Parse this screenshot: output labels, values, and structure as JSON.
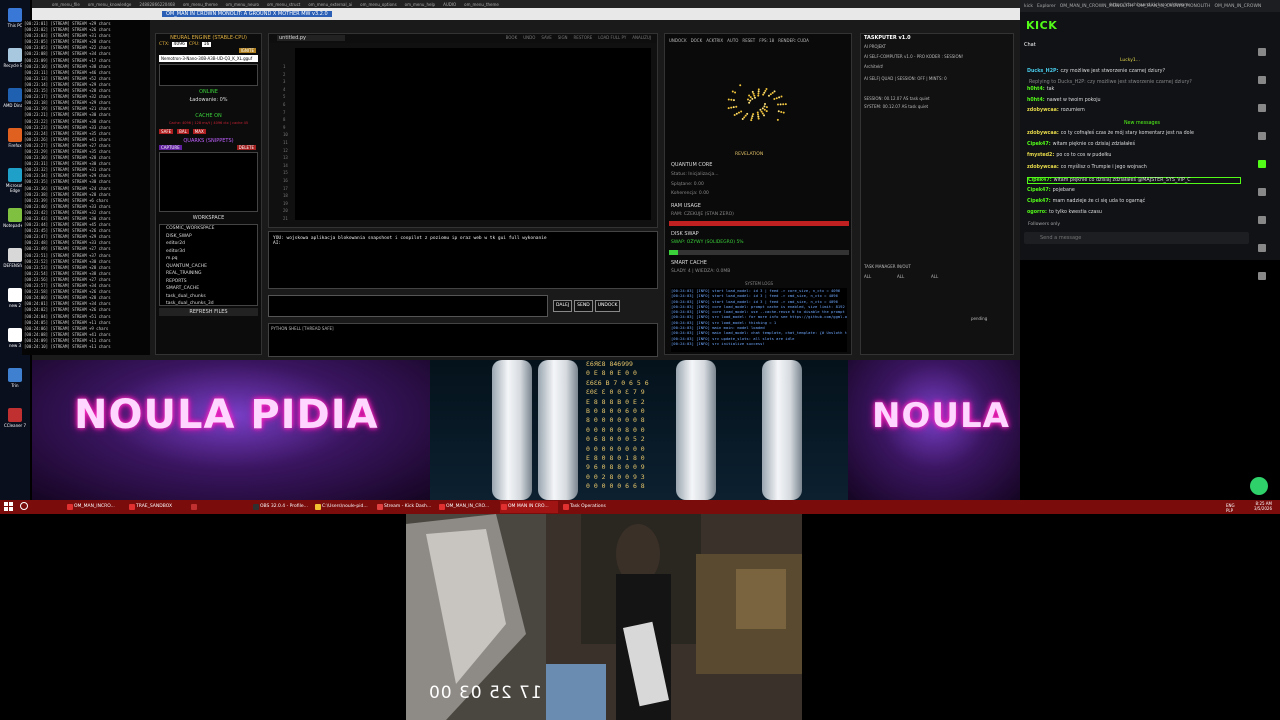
{
  "desktop": {
    "icons": [
      {
        "name": "recycle-bin-icon",
        "label": "This PC",
        "color": "#3a78d8"
      },
      {
        "name": "recycle-bin-icon-2",
        "label": "Recycle Bin",
        "color": "#a8c8e0"
      },
      {
        "name": "amd-icon",
        "label": "AMD Dina...",
        "color": "#2060b0"
      },
      {
        "name": "firefox-icon",
        "label": "Firefox",
        "color": "#e06020"
      },
      {
        "name": "edge-icon",
        "label": "Microsoft Edge",
        "color": "#1fa0c8"
      },
      {
        "name": "notepad-icon",
        "label": "Notepad++",
        "color": "#80c040"
      },
      {
        "name": "file-icon",
        "label": "DEFENSIV...",
        "color": "#d8d8d8"
      },
      {
        "name": "file-icon-2",
        "label": "new 2",
        "color": "#ffffff"
      },
      {
        "name": "file-icon-3",
        "label": "new 3",
        "color": "#ffffff"
      },
      {
        "name": "app-icon",
        "label": "Trin",
        "color": "#4080d0"
      },
      {
        "name": "ccleaner-icon",
        "label": "CCleaner 7",
        "color": "#c03030"
      }
    ]
  },
  "window": {
    "title": "OM_MAN IN CROWN MONOLIT: A GROUND X MOTHER MW v3.2.0",
    "tabs": [
      "om_menu_file",
      "om_menu_knowledge",
      "24882866220468",
      "om_menu_theme",
      "om_menu_neuro",
      "om_menu_struct",
      "om_menu_external_ai",
      "om_menu_options",
      "om_menu_help",
      "AUDIO",
      "om_menu_theme"
    ],
    "menu": [
      "File",
      "Edit",
      "View",
      "Tools",
      "Window",
      "Help"
    ]
  },
  "log": {
    "lines": [
      "[00:23:01] [STREAM] STREAM +29 chars",
      "[00:23:02] [STREAM] STREAM +26 chars",
      "[00:23:03] [STREAM] STREAM +31 chars",
      "[00:23:05] [STREAM] STREAM +28 chars",
      "[00:23:05] [STREAM] STREAM +22 chars",
      "[00:23:08] [STREAM] STREAM +34 chars",
      "[00:23:09] [STREAM] STREAM +17 chars",
      "[00:23:10] [STREAM] STREAM +38 chars",
      "[00:23:11] [STREAM] STREAM +46 chars",
      "[00:23:13] [STREAM] STREAM +52 chars",
      "[00:23:14] [STREAM] STREAM +29 chars",
      "[00:23:15] [STREAM] STREAM +28 chars",
      "[00:23:17] [STREAM] STREAM +32 chars",
      "[00:23:18] [STREAM] STREAM +29 chars",
      "[00:23:19] [STREAM] STREAM +21 chars",
      "[00:23:21] [STREAM] STREAM +30 chars",
      "[00:23:22] [STREAM] STREAM +38 chars",
      "[00:23:23] [STREAM] STREAM +33 chars",
      "[00:23:24] [STREAM] STREAM +35 chars",
      "[00:23:26] [STREAM] STREAM +41 chars",
      "[00:23:27] [STREAM] STREAM +27 chars",
      "[00:23:29] [STREAM] STREAM +35 chars",
      "[00:23:30] [STREAM] STREAM +28 chars",
      "[00:23:31] [STREAM] STREAM +30 chars",
      "[00:23:32] [STREAM] STREAM +31 chars",
      "[00:23:34] [STREAM] STREAM +29 chars",
      "[00:23:35] [STREAM] STREAM +30 chars",
      "[00:23:36] [STREAM] STREAM +24 chars",
      "[00:23:38] [STREAM] STREAM +28 chars",
      "[00:23:39] [STREAM] STREAM +6 chars",
      "[00:23:40] [STREAM] STREAM +33 chars",
      "[00:23:42] [STREAM] STREAM +32 chars",
      "[00:23:43] [STREAM] STREAM +30 chars",
      "[00:23:44] [STREAM] STREAM +45 chars",
      "[00:23:45] [STREAM] STREAM +26 chars",
      "[00:23:47] [STREAM] STREAM +29 chars",
      "[00:23:48] [STREAM] STREAM +33 chars",
      "[00:23:49] [STREAM] STREAM +27 chars",
      "[00:23:51] [STREAM] STREAM +37 chars",
      "[00:23:52] [STREAM] STREAM +30 chars",
      "[00:23:53] [STREAM] STREAM +28 chars",
      "[00:23:54] [STREAM] STREAM +38 chars",
      "[00:23:56] [STREAM] STREAM +27 chars",
      "[00:23:57] [STREAM] STREAM +34 chars",
      "[00:23:58] [STREAM] STREAM +26 chars",
      "[00:24:00] [STREAM] STREAM +28 chars",
      "[00:24:01] [STREAM] STREAM +34 chars",
      "[00:24:02] [STREAM] STREAM +26 chars",
      "[00:24:04] [STREAM] STREAM +51 chars",
      "[00:24:05] [STREAM] STREAM +11 chars",
      "[00:24:06] [STREAM] STREAM +9 chars",
      "[00:24:08] [STREAM] STREAM +41 chars",
      "[00:24:09] [STREAM] STREAM +11 chars",
      "[00:24:10] [STREAM] STREAM +11 chars"
    ]
  },
  "neural": {
    "title": "NEURAL ENGINE (STABLE-CPU)",
    "ctx_label": "CTX:",
    "ctx_value": "4096",
    "cpu_label": "CPU:",
    "cpu_value": "16",
    "ignite": "IGNITE",
    "model": "Nemotron-3-Nano-30B-A3B-UD-Q3_K_XL.gguf",
    "status": "ONLINE",
    "loading": "Ładowanie: 0%",
    "cache_title": "CACHE ON",
    "cache_info": "Cache: 4096 | 128 ms/t | 4096 ctx | cache 45",
    "btn_safe": "SAFE",
    "btn_bal": "BAL",
    "btn_max": "MAX",
    "quarks_title": "QUARKS (SNIPPETS)",
    "capture": "CAPTURE",
    "delete": "DELETE",
    "workspace_title": "WORKSPACE",
    "tree": [
      "COSMIC_WORKSPACE",
      "DISK_SWAP",
      "editor2d",
      "editor3d",
      "m.pq",
      "QUANTUM_CACHE",
      "REAL_TRAINING",
      "REPORTS",
      "SMART_CACHE",
      "task_dual_chunks",
      "task_dual_chunks_3d"
    ],
    "refresh": "REFRESH FILES"
  },
  "editor": {
    "filename": "untitled.py",
    "tools": [
      "BOOK",
      "UNDO",
      "SAVE",
      "SIGN",
      "RESTORE",
      "LOAD FULL PY",
      "ANALIZUJ"
    ],
    "output_you": "YOU: wojskowa aplikacja blokowania snapshoot i coopilot z poziomu ip oraz web w tk gui full wykonanie",
    "output_ai": "AI:",
    "btn_dale": "DALEJ",
    "btn_send": "SEND",
    "btn_undock": "UNDOCK",
    "shell_label": "PYTHON SHELL [THREAD SAFE]"
  },
  "quantum": {
    "toolbar": [
      "UNDOCK",
      "DOCK",
      "ACKTRIX",
      "AUTO",
      "RESET",
      "FPS: 18",
      "RENDER: CUDA"
    ],
    "revelation": "REVELATION",
    "core_title": "QUANTUM CORE",
    "core_status": "Status: Inicjalizacja...",
    "core_splatane": "Splątane: 0.00",
    "core_koherencja": "Koherencja: 0.00",
    "ram_title": "RAM USAGE",
    "ram_sub": "RAM: CZEKUJE (STAN ZERO)",
    "swap_title": "DISK SWAP",
    "swap_sub": "SWAP: OŻYWY (SOLIDEGRO) 5%",
    "smart_title": "SMART CACHE",
    "smart_sub": "ŚLADY: 4 | WIEDZA: 0.0MB",
    "syslog_title": "SYSTEM LOGS",
    "syslog": [
      "[00:24:03] [INFO] start   load_model: id 3 | feed -> core_size, n_ctx = 4096",
      "[00:24:03] [INFO] start   load_model: id 3 | feed -> cmd_size, n_ctx = 4096",
      "[00:24:03] [INFO] start   load_model: id 3 | feed -> cmd_size, n_ctx = 4096",
      "[00:24:03] [INFO] core    load_model: prompt cache is enabled, size limit: 8192 MiB",
      "[00:24:03] [INFO] core    load_model: use --cache-reuse N to disable the prompt cache",
      "[00:24:03] [INFO] srv     load_model: for more info see https://github.com/ggml-org",
      "[00:24:03] [INFO] srv     load_model: thinking = 1",
      "[00:24:03] [INFO] main    main: model loaded",
      "[00:24:03] [INFO] main    load_model: chat template, chat_template: {# Unsloth template fix #}",
      "[00:24:03] [INFO] srv     update_slots: all slots are idle",
      "[00:24:03] [INFO] srv     initialize success!"
    ]
  },
  "taskputer": {
    "title": "TASKPUTER v1.0",
    "rows": [
      "AI PROJEKT",
      "AI SELF-COMPUTER v1.0 - PRO KODER : SESSION!",
      "Architekt!",
      "AI SELF| QUAD | SESSION: OFF | MINTS: 0",
      "SESSION: 00.12.07 AS task quiet",
      "SYSTEM: 00.12.07 AS task quiet",
      "TASK MANAGER IN/OUT",
      "ALL",
      "ALL",
      "ALL",
      "pending"
    ]
  },
  "banner": {
    "title_left": "NOULA PIDIA",
    "title_right": "NOULA PIDIA",
    "digits": [
      "Ɛ6ЯƐ8 846999",
      "0 E 8 0 E 0 0",
      "Ɛ6Ɛ6 B 7 0 6 5 6",
      "Ɛ0Ɛ Ɛ 0 0 Ɛ 7 9",
      "E 8 8 8 B 0 E 2",
      "B 0 8 0 0 6 0 0",
      "8 0 0 0 0 0 0 8",
      "0 0 0 0 0 8 0 0",
      "0 6 8 0 0 0 5 2",
      "0 0 0 0 0 0 0 0",
      "E 8 0 8 0 1 8 0",
      "9 6 0 8 8 0 0 9",
      "0 0 2 8 0 0 9 3",
      "0 0 0 0 0 6 6 8"
    ]
  },
  "chat": {
    "browser_tabs": [
      "kick",
      "Explorer",
      "OM_MAN_IN_CROWN_MONOLITH",
      "OM_MAN_IN_CROWN_MONOLITH",
      "OM_MAN_IN_CROWN"
    ],
    "url": "https://dashboard.kick.com/stream",
    "logo": "KICK",
    "header": "Chat",
    "pinned_user": "Lucky1...",
    "messages": [
      {
        "user": "Ducks_H2P:",
        "text": "czy możliwe jest stworzenie czarnej dziury?",
        "cls": "c"
      },
      {
        "user": "",
        "text": "Replying to Ducks_H2P: czy możliwe jest stworzenie czarnej dziury?",
        "cls": ""
      },
      {
        "user": "h0ht4:",
        "text": "tak",
        "cls": ""
      },
      {
        "user": "h0ht4:",
        "text": "nawet w twoim pokoju",
        "cls": ""
      },
      {
        "user": "zdobywcaa:",
        "text": "rozumiem",
        "cls": "y"
      },
      {
        "user": "zdobywcaa:",
        "text": "co ty cofnąłeś czas że mój stary komentarz jest na dole",
        "cls": "y"
      },
      {
        "user": "Cipek47:",
        "text": "witam pięknie co dzisiaj zdziałałeś",
        "cls": ""
      },
      {
        "user": "fmysted2:",
        "text": "po co to cos w pudełku",
        "cls": "y"
      },
      {
        "user": "zdobywcaa:",
        "text": "co myślisz o Trumpie i jego wojnach",
        "cls": "y"
      },
      {
        "user": "Cipek47:",
        "text": "witam pięknie co dzisiaj zdziałałeś @MAJSTER_SYS_VIP_C",
        "cls": ""
      },
      {
        "user": "Cipek47:",
        "text": "pojebane",
        "cls": ""
      },
      {
        "user": "Cipek47:",
        "text": "mam nadzieje że ci się uda to ogarnąć",
        "cls": ""
      },
      {
        "user": "ogorro:",
        "text": "to tylko kwestia czasu",
        "cls": ""
      }
    ],
    "new_messages": "New messages",
    "followers_only": "Followers only",
    "input_placeholder": "Send a message"
  },
  "taskbar": {
    "items": [
      {
        "label": "OM_MAN_INCRO...",
        "active": false,
        "color": "#e03030"
      },
      {
        "label": "TRAE_SANDBOX",
        "active": false,
        "color": "#e03030"
      },
      {
        "label": "",
        "active": false,
        "color": "#c03030"
      },
      {
        "label": "OBS 32.0.4 - Profile...",
        "active": false,
        "color": "#303030"
      },
      {
        "label": "C:\\Users\\noule-pid...",
        "active": false,
        "color": "#f0c030"
      },
      {
        "label": "Stream - Kick Dash...",
        "active": false,
        "color": "#e04040"
      },
      {
        "label": "OM_MAN_IN_CRO...",
        "active": false,
        "color": "#e03030"
      },
      {
        "label": "OM MAN IN CRO...",
        "active": true,
        "color": "#e03030"
      },
      {
        "label": "Task Operations",
        "active": false,
        "color": "#e03030"
      }
    ],
    "lang": "ENG PLP",
    "time": "8:25 AM",
    "date": "3/5/2026"
  },
  "webcam": {
    "timestamp": "17 25 03 00"
  }
}
